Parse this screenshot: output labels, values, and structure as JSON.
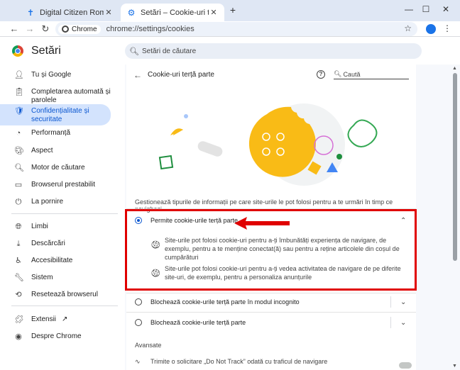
{
  "browser": {
    "tabs": [
      {
        "title": "Digital Citizen România - Viața",
        "icon": "plus-cross-icon"
      },
      {
        "title": "Setări – Cookie-uri terță parte",
        "icon": "gear-icon"
      }
    ],
    "new_tab": "+",
    "window_controls": {
      "minimize": "—",
      "maximize": "☐",
      "close": "✕"
    },
    "omnibox": {
      "chip": "Chrome",
      "url": "chrome://settings/cookies"
    }
  },
  "settings": {
    "title": "Setări",
    "search_placeholder": "Setări de căutare"
  },
  "sidebar": {
    "items": [
      {
        "label": "Tu și Google",
        "icon": "person-icon"
      },
      {
        "label": "Completarea automată și parolele",
        "icon": "clipboard-icon"
      },
      {
        "label": "Confidențialitate și securitate",
        "icon": "shield-icon",
        "active": true
      },
      {
        "label": "Performanță",
        "icon": "gauge-icon"
      },
      {
        "label": "Aspect",
        "icon": "palette-icon"
      },
      {
        "label": "Motor de căutare",
        "icon": "search-icon"
      },
      {
        "label": "Browserul prestabilit",
        "icon": "browser-icon"
      },
      {
        "label": "La pornire",
        "icon": "power-icon"
      },
      {
        "label": "Limbi",
        "icon": "globe-icon"
      },
      {
        "label": "Descărcări",
        "icon": "download-icon"
      },
      {
        "label": "Accesibilitate",
        "icon": "accessibility-icon"
      },
      {
        "label": "Sistem",
        "icon": "wrench-icon"
      },
      {
        "label": "Resetează browserul",
        "icon": "reset-icon"
      },
      {
        "label": "Extensii",
        "icon": "puzzle-icon"
      },
      {
        "label": "Despre Chrome",
        "icon": "chrome-icon"
      }
    ]
  },
  "page": {
    "title": "Cookie-uri terță parte",
    "search_placeholder": "Caută",
    "description": "Gestionează tipurile de informații pe care site-urile le pot folosi pentru a te urmări în timp ce navighezi.",
    "options": [
      {
        "label": "Permite cookie-urile terță parte",
        "selected": true,
        "expanded": true
      },
      {
        "label": "Blochează cookie-urile terță parte în modul incognito",
        "selected": false
      },
      {
        "label": "Blochează cookie-urile terță parte",
        "selected": false
      }
    ],
    "details": [
      "Site-urile pot folosi cookie-uri pentru a-ți îmbunătăți experiența de navigare, de exemplu, pentru a te menține conectat(ă) sau pentru a reține articolele din coșul de cumpărături",
      "Site-urile pot folosi cookie-uri pentru a-ți vedea activitatea de navigare de pe diferite site-uri, de exemplu, pentru a personaliza anunțurile"
    ],
    "advanced_label": "Avansate",
    "dnt_label": "Trimite o solicitare „Do Not Track” odată cu traficul de navigare"
  },
  "colors": {
    "accent": "#0b57d0",
    "annotation": "#e00000",
    "cookie": "#f9bb16"
  }
}
